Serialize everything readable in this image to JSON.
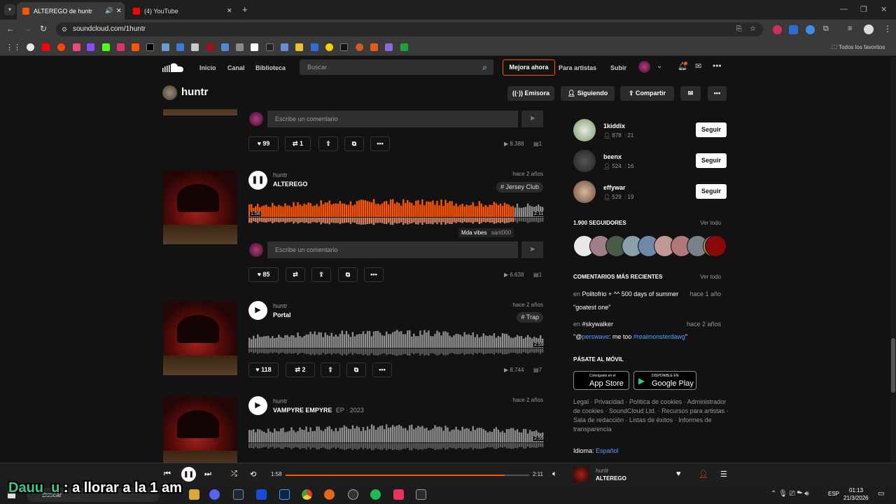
{
  "browser": {
    "tabs": [
      {
        "title": "ALTEREGO de huntr",
        "active": true
      },
      {
        "title": "(4) YouTube",
        "active": false
      }
    ],
    "url": "soundcloud.com/1huntr",
    "favorites_label": "Todos los favoritos"
  },
  "nav": {
    "home": "Inicio",
    "feed": "Canal",
    "library": "Biblioteca",
    "search_placeholder": "Buscar",
    "upgrade": "Mejora ahora",
    "artists": "Para artistas",
    "upload": "Subir"
  },
  "profile": {
    "name": "huntr",
    "station": "Emisora",
    "following": "Siguiendo",
    "share": "Compartir"
  },
  "tracks": [
    {
      "comment_placeholder": "Escribe un comentario",
      "likes": "99",
      "reposts": "1",
      "plays": "8.388",
      "comments": "1"
    },
    {
      "user": "huntr",
      "title": "ALTEREGO",
      "ago": "hace 2 años",
      "tag": "# Jersey Club",
      "elapsed": "1:58",
      "duration": "2:11",
      "progress": 0.9,
      "comment_user": "Mda vibes",
      "comment_text": "sant000",
      "comment_placeholder": "Escribe un comentario",
      "likes": "85",
      "plays": "6.638",
      "comments": "1"
    },
    {
      "user": "huntr",
      "title": "Portal",
      "ago": "hace 2 años",
      "tag": "# Trap",
      "duration": "2:59",
      "likes": "118",
      "reposts": "2",
      "plays": "8.744",
      "comments": "7"
    },
    {
      "user": "huntr",
      "title": "VAMPYRE EMPYRE",
      "subtitle": "EP · 2023",
      "ago": "hace 2 años",
      "duration": "2:59"
    }
  ],
  "sidebar": {
    "suggest": [
      {
        "name": "1kiddix",
        "followers": "878",
        "tracks": "21"
      },
      {
        "name": "beenx",
        "followers": "524",
        "tracks": "16"
      },
      {
        "name": "effywar",
        "followers": "529",
        "tracks": "19"
      }
    ],
    "follow_label": "Seguir",
    "followers_title": "1.900 SEGUIDORES",
    "see_all": "Ver todo",
    "comments_title": "COMENTARIOS MÁS RECIENTES",
    "comments": [
      {
        "prefix": "en",
        "track": "Politofrio + ^^ 500 days of summer",
        "time": "hace 1 año",
        "text": "\"goatest one\""
      },
      {
        "prefix": "en",
        "track": "#skywalker",
        "time": "hace 2 años",
        "text_pre": "\"@",
        "mention": "perswave",
        "text_mid": ": me too ",
        "hashtag": "#realmonsterdawg",
        "text_post": "\""
      }
    ],
    "mobile_title": "PÁSATE AL MÓVIL",
    "appstore_small": "Consíguelo en el",
    "appstore_big": "App Store",
    "play_small": "DISPONIBLE EN",
    "play_big": "Google Play",
    "footer": "Legal · Privacidad · Política de cookies · Administrador de cookies · SoundCloud Ltd. · Recursos para artistas · Sala de redacción · Listas de éxitos · Informes de transparencia",
    "language_label": "Idioma:",
    "language": "Español"
  },
  "player": {
    "elapsed": "1:58",
    "duration": "2:11",
    "progress": 0.9,
    "artist": "huntr",
    "title": "ALTEREGO"
  },
  "taskbar": {
    "search": "Buscar",
    "lang": "ESP",
    "time": "01:13",
    "date": "21/3/2026"
  },
  "overlay": {
    "name": "Dauu_u",
    "text": " : a llorar a la 1 am"
  },
  "colors": {
    "accent": "#ff5500",
    "bg": "#121212"
  }
}
